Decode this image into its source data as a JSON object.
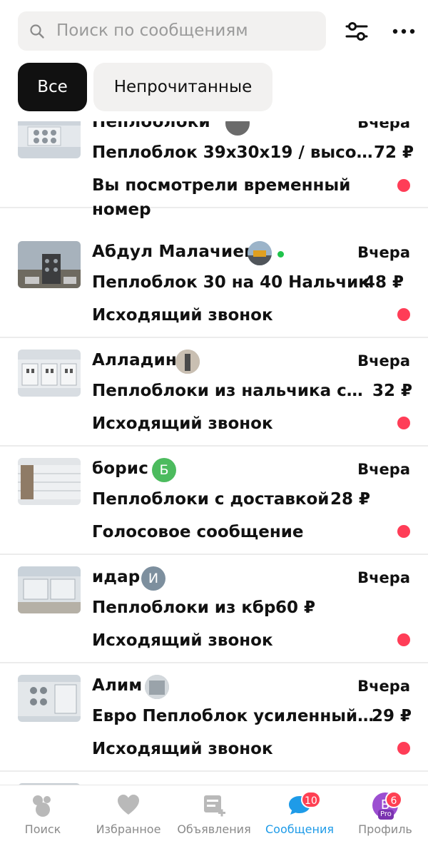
{
  "search": {
    "placeholder": "Поиск по сообщениям"
  },
  "filters": {
    "all": "Все",
    "unread": "Непрочитанные"
  },
  "chats": [
    {
      "name": "Пеплоблоки",
      "date": "Вчера",
      "title": "Пеплоблок 39x30x19 / высо…",
      "price": "72 ₽",
      "preview": "Вы посмотрели временный номер",
      "unread": true
    },
    {
      "name": "Абдул Малачиев",
      "date": "Вчера",
      "title": "Пеплоблок 30 на 40 Нальчик",
      "price": "48 ₽",
      "preview": "Исходящий звонок",
      "online": true,
      "unread": true
    },
    {
      "name": "Алладин",
      "date": "Вчера",
      "title": "Пеплоблоки из нальчика с…",
      "price": "32 ₽",
      "preview": "Исходящий звонок",
      "unread": true
    },
    {
      "name": "борис",
      "avatar_letter": "Б",
      "date": "Вчера",
      "title": "Пеплоблоки с доставкой",
      "price": "28 ₽",
      "preview": "Голосовое сообщение",
      "unread": true
    },
    {
      "name": "идар",
      "avatar_letter": "И",
      "date": "Вчера",
      "title": "Пеплоблоки из кбр",
      "price": "60 ₽",
      "preview": "Исходящий звонок",
      "unread": true
    },
    {
      "name": "Алим",
      "date": "Вчера",
      "title": "Евро Пеплоблок усиленный…",
      "price": "29 ₽",
      "preview": "Исходящий звонок",
      "unread": true
    }
  ],
  "tabs": [
    {
      "label": "Поиск",
      "icon": "search-bubbles-icon"
    },
    {
      "label": "Избранное",
      "icon": "heart-icon"
    },
    {
      "label": "Объявления",
      "icon": "ads-add-icon"
    },
    {
      "label": "Сообщения",
      "icon": "chat-icon",
      "badge": "10",
      "active": true
    },
    {
      "label": "Профиль",
      "icon": "profile-avatar-icon",
      "badge": "6",
      "avatar_letter": "Б",
      "pro_label": "Pro"
    }
  ],
  "colors": {
    "accent": "#1e9be8",
    "unread_dot": "#ff3d57",
    "badge": "#ff4053",
    "online": "#1fc34b"
  }
}
